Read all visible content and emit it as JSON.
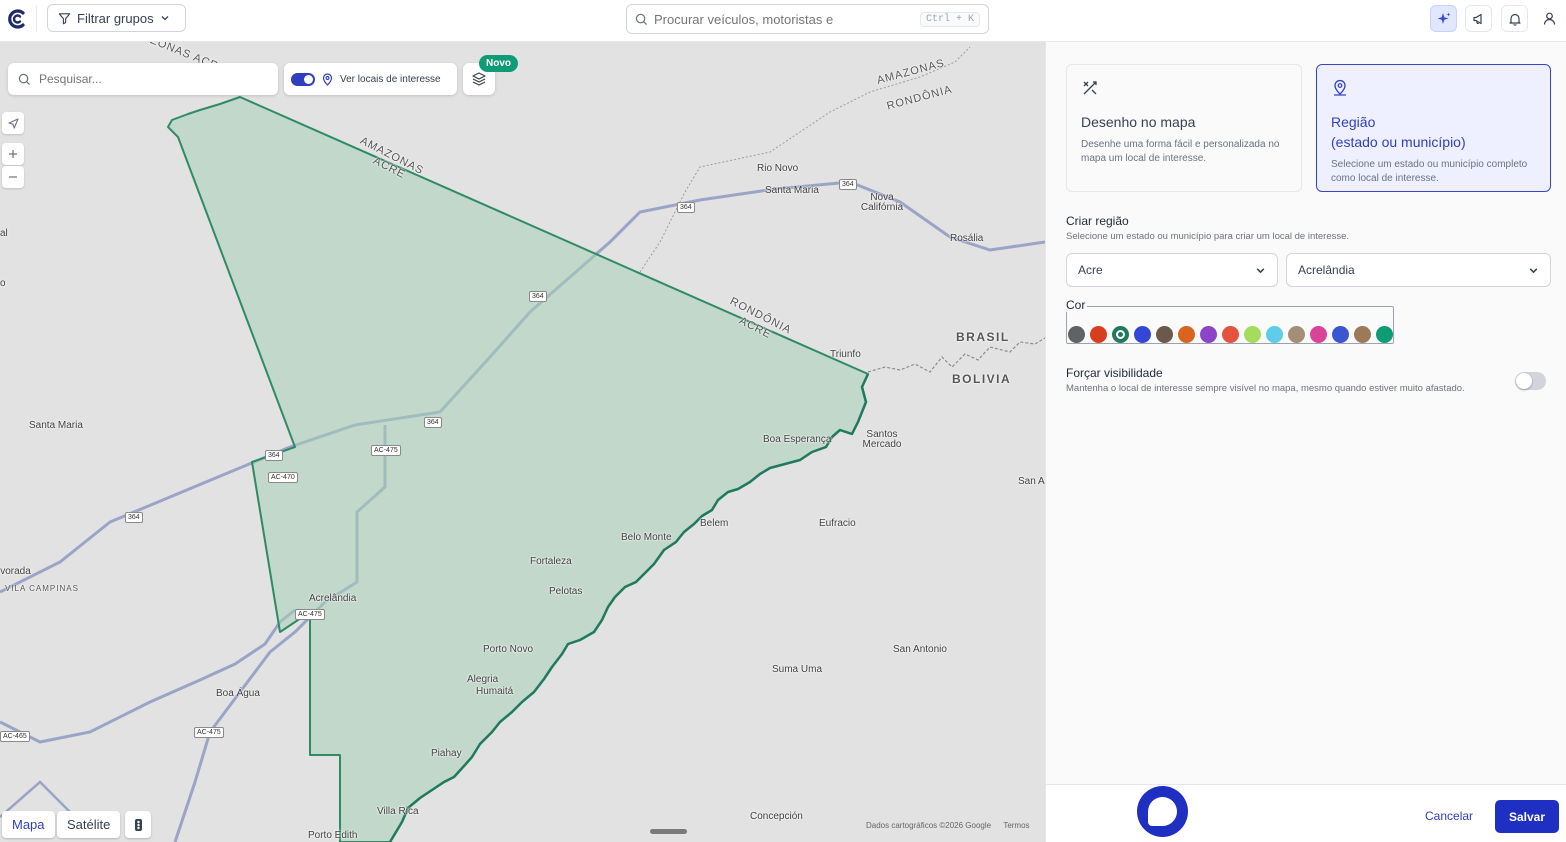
{
  "header": {
    "filter_label": "Filtrar grupos",
    "search_placeholder": "Procurar veículos, motoristas e",
    "search_shortcut": "Ctrl + K"
  },
  "map": {
    "search_placeholder": "Pesquisar...",
    "poi_toggle_label": "Ver locais de interesse",
    "novo_badge": "Novo",
    "maptype_map": "Mapa",
    "maptype_satellite": "Satélite",
    "attribution": "Dados cartográficos ©2026 Google",
    "terms": "Termos",
    "labels": {
      "amazonas_acre_top": "AMAZONAS ACRE",
      "amazonas_ne": "AMAZONAS",
      "rondonia_ne": "RONDÔNIA",
      "amazonas_diag": "AMAZONAS",
      "acre_diag": "ACRE",
      "rondonia_diag": "RONDÔNIA",
      "acre_diag2": "ACRE",
      "brasil": "BRASIL",
      "bolivia": "BOLIVIA",
      "rio_novo": "Rio Novo",
      "santa_maria_ne": "Santa Maria",
      "nova_california": "Nova Califórnia",
      "rosalia": "Rosália",
      "triunfo": "Triunfo",
      "santa_maria_w": "Santa Maria",
      "boa_esperanca": "Boa Esperança",
      "santos_mercado": "Santos Mercado",
      "san_a": "San A",
      "belem": "Belem",
      "eufracio": "Eufracio",
      "belo_monte": "Belo Monte",
      "fortaleza": "Fortaleza",
      "pelotas": "Pelotas",
      "acrelandia": "Acrelândia",
      "vorada": "ivorada",
      "vila_campinas": "VILA CAMPINAS",
      "porto_novo": "Porto Novo",
      "san_antonio": "San Antonio",
      "suma_uma": "Suma Uma",
      "alegria": "Alegria",
      "humaita": "Humaitá",
      "boa_agua": "Boa Água",
      "piahay": "Piahay",
      "vila_rica": "Villa Rica",
      "concepcion": "Concepción",
      "porto_edith": "Porto Edith",
      "edge_al": "al",
      "edge_o": "o",
      "shield_364": "364",
      "shield_ac475": "AC-475",
      "shield_ac470": "AC-470",
      "shield_ac465": "AC-465"
    }
  },
  "panel": {
    "draw_title": "Desenho no mapa",
    "draw_desc": "Desenhe uma forma fácil e personalizada no mapa um local de interesse.",
    "region_title_line1": "Região",
    "region_title_line2": "(estado ou município)",
    "region_desc": "Selecione um estado ou município completo como local de interesse.",
    "create_title": "Criar região",
    "create_desc": "Selecione um estado ou município para criar um local de interesse.",
    "state_value": "Acre",
    "city_value": "Acrelândia",
    "color_label": "Cor",
    "colors": [
      "#5f6368",
      "#d63e1f",
      "#1f7a5e",
      "#3446d6",
      "#6b5a4c",
      "#d9641f",
      "#8e44c8",
      "#e5533e",
      "#a4dc5c",
      "#5dcde8",
      "#a48e78",
      "#d9439a",
      "#3b56d2",
      "#9b7a5a",
      "#0f9b76"
    ],
    "selected_color": "#1f7a5e",
    "visibility_title": "Forçar visibilidade",
    "visibility_desc": "Mantenha o local de interesse sempre visível no mapa, mesmo quando estiver muito afastado.",
    "visibility_on": false,
    "cancel_label": "Cancelar",
    "save_label": "Salvar"
  }
}
